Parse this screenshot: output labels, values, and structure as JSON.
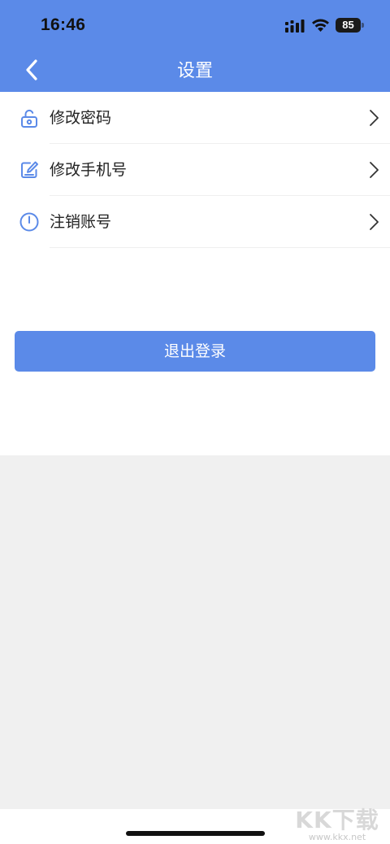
{
  "status_bar": {
    "time": "16:46",
    "battery_level": "85"
  },
  "header": {
    "title": "设置"
  },
  "settings": {
    "items": [
      {
        "label": "修改密码",
        "icon": "unlock-icon"
      },
      {
        "label": "修改手机号",
        "icon": "edit-icon"
      },
      {
        "label": "注销账号",
        "icon": "power-icon"
      }
    ]
  },
  "logout": {
    "label": "退出登录"
  },
  "watermark": {
    "brand": "KK下载",
    "url": "www.kkx.net"
  },
  "colors": {
    "primary": "#5b8ae8",
    "background_gray": "#f0f0f0",
    "text": "#222222"
  }
}
